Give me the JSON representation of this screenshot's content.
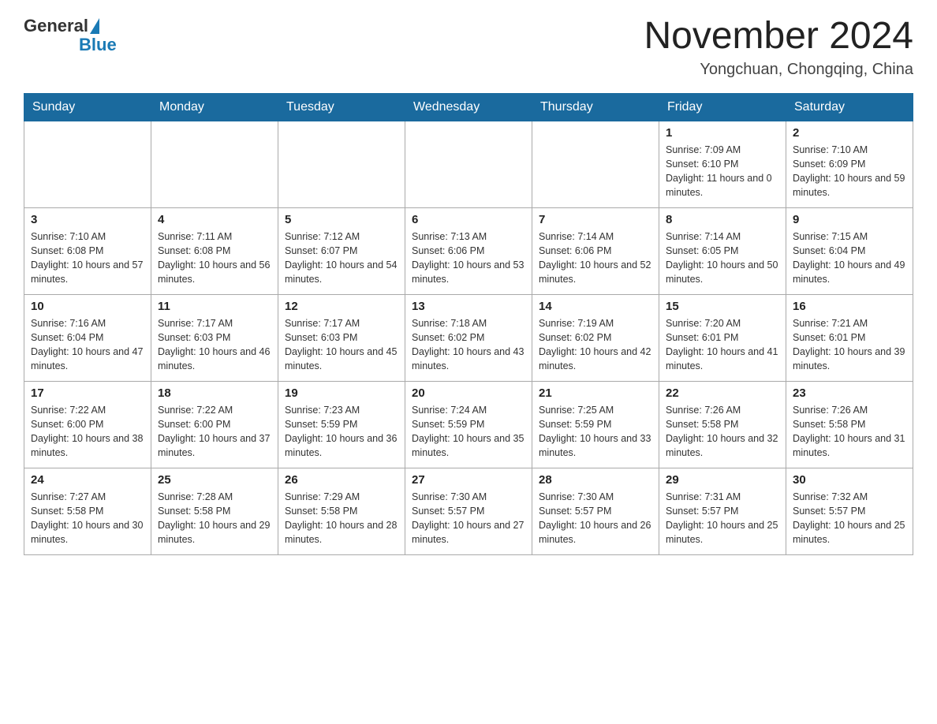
{
  "header": {
    "logo_general": "General",
    "logo_blue": "Blue",
    "month_title": "November 2024",
    "location": "Yongchuan, Chongqing, China"
  },
  "days_of_week": [
    "Sunday",
    "Monday",
    "Tuesday",
    "Wednesday",
    "Thursday",
    "Friday",
    "Saturday"
  ],
  "weeks": [
    [
      {
        "day": "",
        "info": ""
      },
      {
        "day": "",
        "info": ""
      },
      {
        "day": "",
        "info": ""
      },
      {
        "day": "",
        "info": ""
      },
      {
        "day": "",
        "info": ""
      },
      {
        "day": "1",
        "info": "Sunrise: 7:09 AM\nSunset: 6:10 PM\nDaylight: 11 hours and 0 minutes."
      },
      {
        "day": "2",
        "info": "Sunrise: 7:10 AM\nSunset: 6:09 PM\nDaylight: 10 hours and 59 minutes."
      }
    ],
    [
      {
        "day": "3",
        "info": "Sunrise: 7:10 AM\nSunset: 6:08 PM\nDaylight: 10 hours and 57 minutes."
      },
      {
        "day": "4",
        "info": "Sunrise: 7:11 AM\nSunset: 6:08 PM\nDaylight: 10 hours and 56 minutes."
      },
      {
        "day": "5",
        "info": "Sunrise: 7:12 AM\nSunset: 6:07 PM\nDaylight: 10 hours and 54 minutes."
      },
      {
        "day": "6",
        "info": "Sunrise: 7:13 AM\nSunset: 6:06 PM\nDaylight: 10 hours and 53 minutes."
      },
      {
        "day": "7",
        "info": "Sunrise: 7:14 AM\nSunset: 6:06 PM\nDaylight: 10 hours and 52 minutes."
      },
      {
        "day": "8",
        "info": "Sunrise: 7:14 AM\nSunset: 6:05 PM\nDaylight: 10 hours and 50 minutes."
      },
      {
        "day": "9",
        "info": "Sunrise: 7:15 AM\nSunset: 6:04 PM\nDaylight: 10 hours and 49 minutes."
      }
    ],
    [
      {
        "day": "10",
        "info": "Sunrise: 7:16 AM\nSunset: 6:04 PM\nDaylight: 10 hours and 47 minutes."
      },
      {
        "day": "11",
        "info": "Sunrise: 7:17 AM\nSunset: 6:03 PM\nDaylight: 10 hours and 46 minutes."
      },
      {
        "day": "12",
        "info": "Sunrise: 7:17 AM\nSunset: 6:03 PM\nDaylight: 10 hours and 45 minutes."
      },
      {
        "day": "13",
        "info": "Sunrise: 7:18 AM\nSunset: 6:02 PM\nDaylight: 10 hours and 43 minutes."
      },
      {
        "day": "14",
        "info": "Sunrise: 7:19 AM\nSunset: 6:02 PM\nDaylight: 10 hours and 42 minutes."
      },
      {
        "day": "15",
        "info": "Sunrise: 7:20 AM\nSunset: 6:01 PM\nDaylight: 10 hours and 41 minutes."
      },
      {
        "day": "16",
        "info": "Sunrise: 7:21 AM\nSunset: 6:01 PM\nDaylight: 10 hours and 39 minutes."
      }
    ],
    [
      {
        "day": "17",
        "info": "Sunrise: 7:22 AM\nSunset: 6:00 PM\nDaylight: 10 hours and 38 minutes."
      },
      {
        "day": "18",
        "info": "Sunrise: 7:22 AM\nSunset: 6:00 PM\nDaylight: 10 hours and 37 minutes."
      },
      {
        "day": "19",
        "info": "Sunrise: 7:23 AM\nSunset: 5:59 PM\nDaylight: 10 hours and 36 minutes."
      },
      {
        "day": "20",
        "info": "Sunrise: 7:24 AM\nSunset: 5:59 PM\nDaylight: 10 hours and 35 minutes."
      },
      {
        "day": "21",
        "info": "Sunrise: 7:25 AM\nSunset: 5:59 PM\nDaylight: 10 hours and 33 minutes."
      },
      {
        "day": "22",
        "info": "Sunrise: 7:26 AM\nSunset: 5:58 PM\nDaylight: 10 hours and 32 minutes."
      },
      {
        "day": "23",
        "info": "Sunrise: 7:26 AM\nSunset: 5:58 PM\nDaylight: 10 hours and 31 minutes."
      }
    ],
    [
      {
        "day": "24",
        "info": "Sunrise: 7:27 AM\nSunset: 5:58 PM\nDaylight: 10 hours and 30 minutes."
      },
      {
        "day": "25",
        "info": "Sunrise: 7:28 AM\nSunset: 5:58 PM\nDaylight: 10 hours and 29 minutes."
      },
      {
        "day": "26",
        "info": "Sunrise: 7:29 AM\nSunset: 5:58 PM\nDaylight: 10 hours and 28 minutes."
      },
      {
        "day": "27",
        "info": "Sunrise: 7:30 AM\nSunset: 5:57 PM\nDaylight: 10 hours and 27 minutes."
      },
      {
        "day": "28",
        "info": "Sunrise: 7:30 AM\nSunset: 5:57 PM\nDaylight: 10 hours and 26 minutes."
      },
      {
        "day": "29",
        "info": "Sunrise: 7:31 AM\nSunset: 5:57 PM\nDaylight: 10 hours and 25 minutes."
      },
      {
        "day": "30",
        "info": "Sunrise: 7:32 AM\nSunset: 5:57 PM\nDaylight: 10 hours and 25 minutes."
      }
    ]
  ]
}
